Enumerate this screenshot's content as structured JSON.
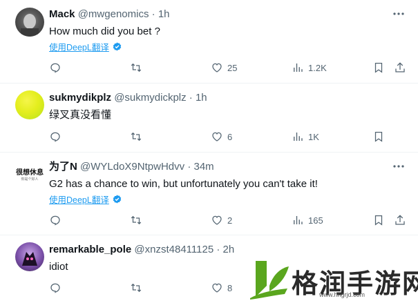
{
  "colors": {
    "accent": "#1d9bf0",
    "muted": "#536471",
    "text": "#0f1419",
    "logo_green": "#5aa61e"
  },
  "tweets": [
    {
      "name": "Mack",
      "handle": "@mwgenomics",
      "dot": "·",
      "time": "1h",
      "text": "How much did you bet ?",
      "translate_label": "使用DeepL翻译",
      "avatar": "photo-avatar",
      "stats": {
        "reply": "",
        "retweet": "",
        "like": "25",
        "views": "1.2K"
      }
    },
    {
      "name": "sukmydikplz",
      "handle": "@sukmydickplz",
      "dot": "·",
      "time": "1h",
      "text": "绿叉真没看懂",
      "translate_label": "",
      "avatar": "yellow-green-gradient-avatar",
      "stats": {
        "reply": "",
        "retweet": "",
        "like": "6",
        "views": "1K"
      }
    },
    {
      "name": "为了N",
      "handle": "@WYLdoX9NtpwHdvv",
      "dot": "·",
      "time": "34m",
      "text": "G2 has a chance to win, but unfortunately you can't take it!",
      "translate_label": "使用DeepL翻译",
      "avatar": "text-avatar",
      "avatar_text": "很想休息",
      "avatar_subtext": "你是个好人",
      "stats": {
        "reply": "",
        "retweet": "",
        "like": "2",
        "views": "165"
      }
    },
    {
      "name": "remarkable_pole",
      "handle": "@xnzst48411125",
      "dot": "·",
      "time": "2h",
      "text": "idiot",
      "translate_label": "",
      "avatar": "anime-character-avatar",
      "stats": {
        "reply": "",
        "retweet": "",
        "like": "8",
        "views": ""
      }
    }
  ],
  "watermark": {
    "title": "格润手游网",
    "url": "www.hngrjd.com",
    "icon": "leaf-logo-icon"
  }
}
